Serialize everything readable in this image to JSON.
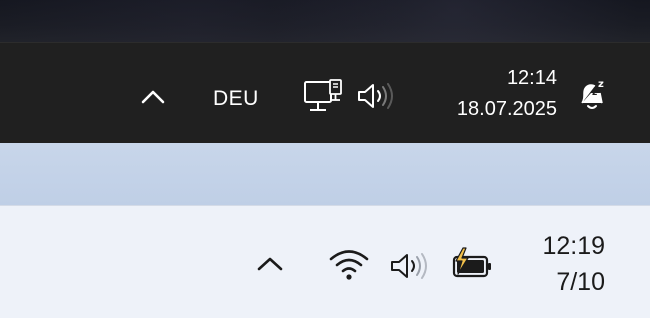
{
  "taskbar_dark": {
    "language": "DEU",
    "time": "12:14",
    "date": "18.07.2025",
    "icons": [
      "chevron-up-icon",
      "network-computer-icon",
      "speaker-icon",
      "notification-bell-snooze-icon"
    ],
    "colors": {
      "background": "#202020",
      "text": "#ffffff"
    }
  },
  "taskbar_light": {
    "time": "12:19",
    "date": "7/10",
    "icons": [
      "chevron-up-icon",
      "wifi-icon",
      "speaker-icon",
      "battery-charging-icon"
    ],
    "colors": {
      "background": "#eef2f9",
      "text": "#1b1b1b"
    }
  }
}
